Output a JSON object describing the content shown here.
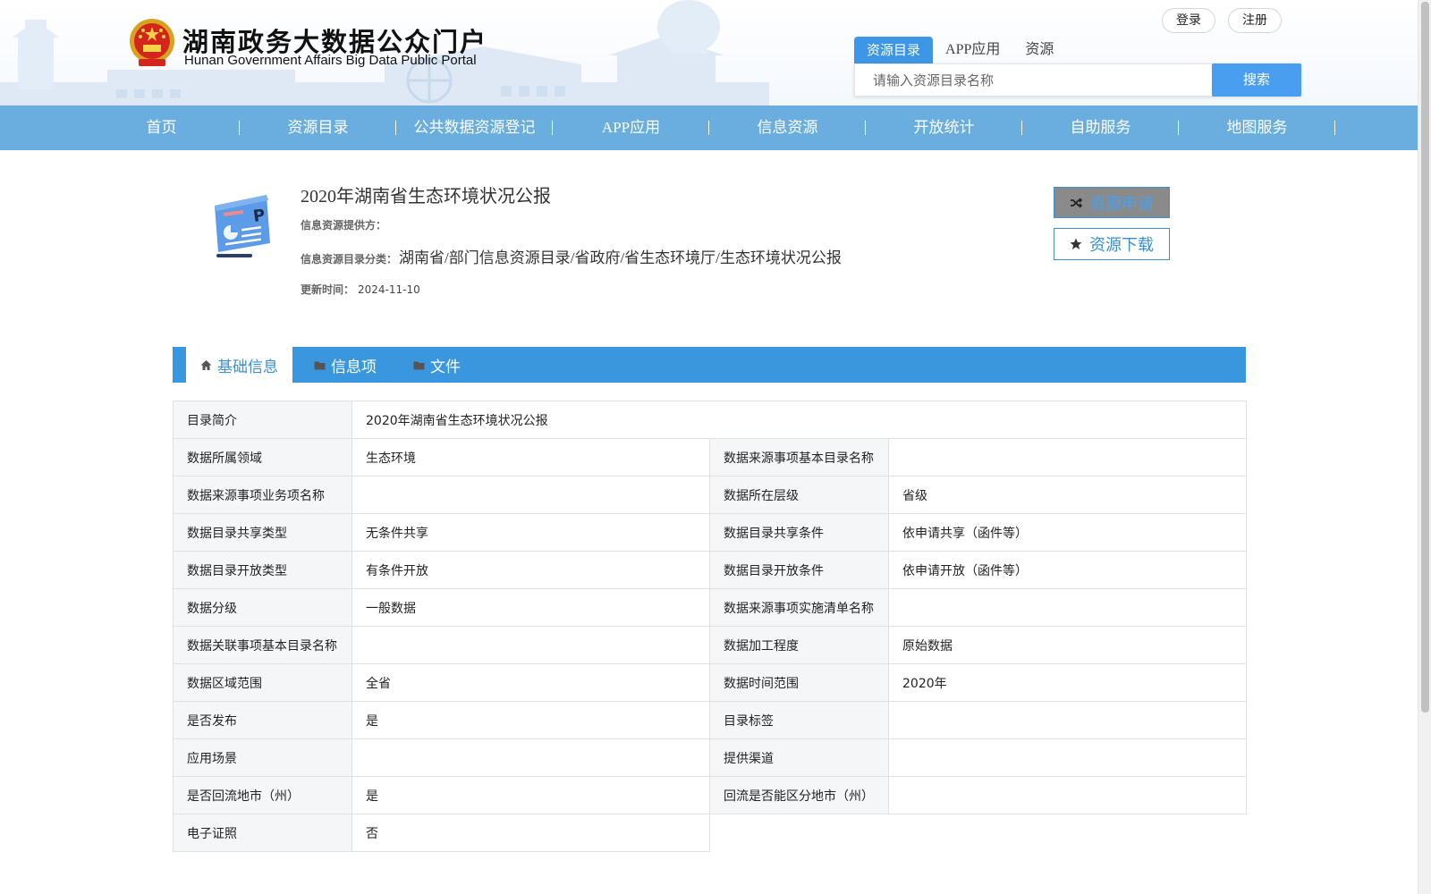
{
  "header": {
    "title_cn": "湖南政务大数据公众门户",
    "title_en": "Hunan Government Affairs Big Data Public Portal",
    "login_label": "登录",
    "register_label": "注册"
  },
  "search": {
    "tabs": [
      "资源目录",
      "APP应用",
      "资源"
    ],
    "active_tab": "资源目录",
    "placeholder": "请输入资源目录名称",
    "button_label": "搜索"
  },
  "nav": {
    "items": [
      "首页",
      "资源目录",
      "公共数据资源登记",
      "APP应用",
      "信息资源",
      "开放统计",
      "自助服务",
      "地图服务"
    ]
  },
  "resource": {
    "title": "2020年湖南省生态环境状况公报",
    "provider_label": "信息资源提供方：",
    "provider_value": "",
    "category_label": "信息资源目录分类：",
    "category_value": "湖南省/部门信息资源目录/省政府/省生态环境厅/生态环境状况公报",
    "updated_label": "更新时间：",
    "updated_value": "2024-11-10",
    "apply_label": "资源申请",
    "download_label": "资源下载"
  },
  "tabs": [
    {
      "label": "基础信息",
      "icon": "home-icon",
      "active": true
    },
    {
      "label": "信息项",
      "icon": "folder-icon",
      "active": false
    },
    {
      "label": "文件",
      "icon": "folder-icon",
      "active": false
    }
  ],
  "table": {
    "intro_label": "目录简介",
    "intro_value": "2020年湖南省生态环境状况公报",
    "rows": [
      {
        "l1": "数据所属领域",
        "v1": "生态环境",
        "l2": "数据来源事项基本目录名称",
        "v2": ""
      },
      {
        "l1": "数据来源事项业务项名称",
        "v1": "",
        "l2": "数据所在层级",
        "v2": "省级"
      },
      {
        "l1": "数据目录共享类型",
        "v1": "无条件共享",
        "l2": "数据目录共享条件",
        "v2": "依申请共享（函件等）"
      },
      {
        "l1": "数据目录开放类型",
        "v1": "有条件开放",
        "l2": "数据目录开放条件",
        "v2": "依申请开放（函件等）"
      },
      {
        "l1": "数据分级",
        "v1": "一般数据",
        "l2": "数据来源事项实施清单名称",
        "v2": ""
      },
      {
        "l1": "数据关联事项基本目录名称",
        "v1": "",
        "l2": "数据加工程度",
        "v2": "原始数据"
      },
      {
        "l1": "数据区域范围",
        "v1": "全省",
        "l2": "数据时间范围",
        "v2": "2020年"
      },
      {
        "l1": "是否发布",
        "v1": "是",
        "l2": "目录标签",
        "v2": ""
      },
      {
        "l1": "应用场景",
        "v1": "",
        "l2": "提供渠道",
        "v2": ""
      },
      {
        "l1": "是否回流地市（州）",
        "v1": "是",
        "l2": "回流是否能区分地市（州）",
        "v2": ""
      }
    ],
    "last_label": "电子证照",
    "last_value": "否"
  },
  "colors": {
    "nav_bg": "#6aaee0",
    "tab_bar": "#3a97de",
    "accent": "#3a8fd8",
    "search_button": "#4a9ef0"
  }
}
